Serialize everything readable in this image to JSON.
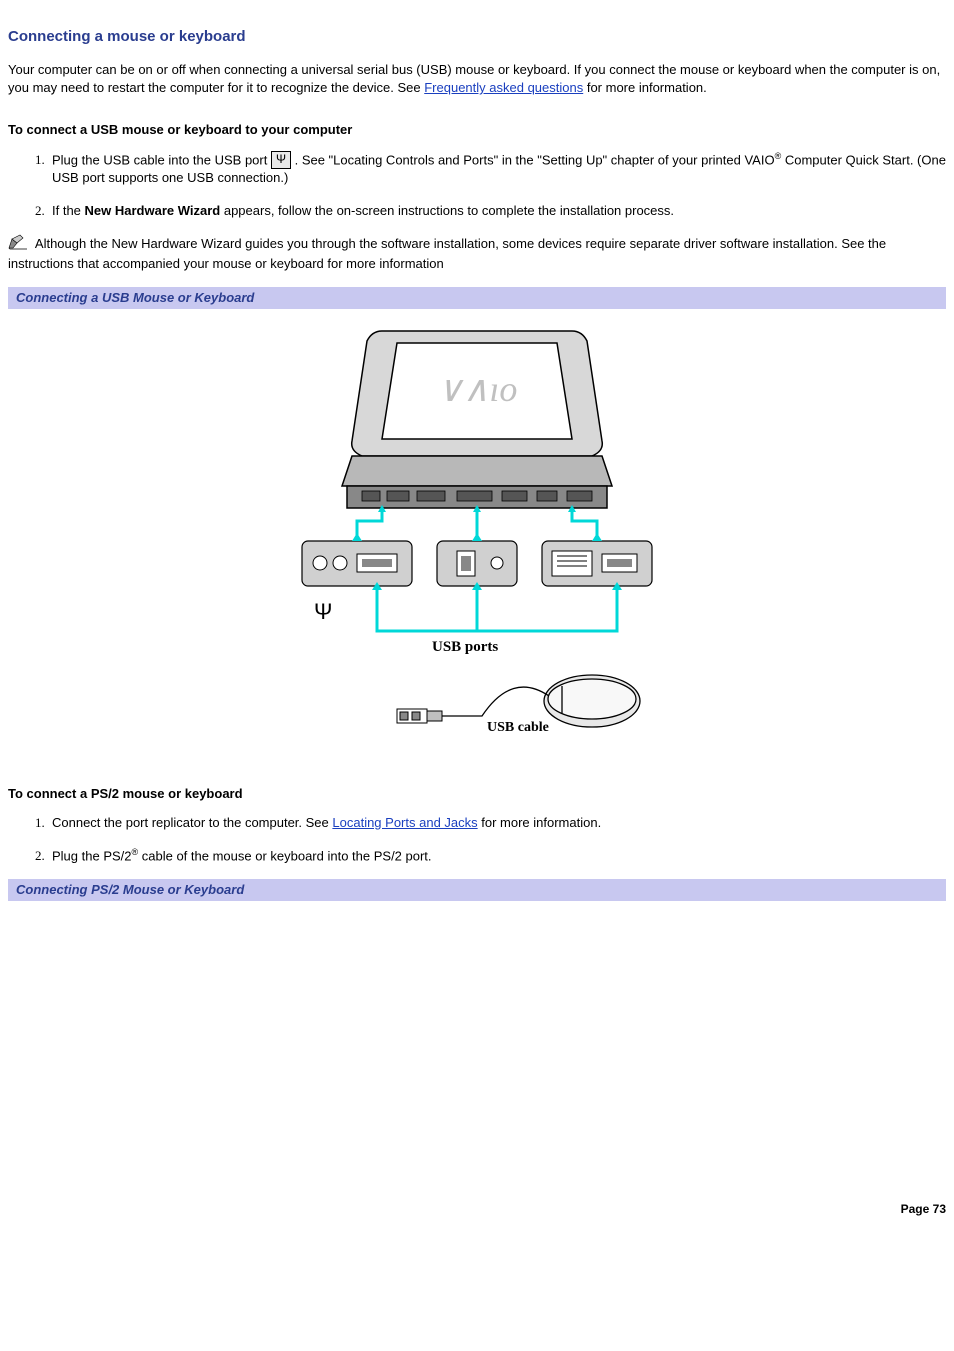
{
  "title": "Connecting a mouse or keyboard",
  "intro_part1": "Your computer can be on or off when connecting a universal serial bus (USB) mouse or keyboard. If you connect the mouse or keyboard when the computer is on, you may need to restart the computer for it to recognize the device. See ",
  "intro_link": "Frequently asked questions",
  "intro_part2": " for more information.",
  "usb_heading": "To connect a USB mouse or keyboard to your computer",
  "usb_step1_a": "Plug the USB cable into the USB port ",
  "usb_step1_b": ". See \"Locating Controls and Ports\" in the \"Setting Up\" chapter of your printed VAIO",
  "usb_step1_c": " Computer Quick Start. (One USB port supports one USB connection.)",
  "usb_step2_a": "If the ",
  "usb_step2_bold": "New Hardware Wizard",
  "usb_step2_b": " appears, follow the on-screen instructions to complete the installation process.",
  "note_text": "Although the New Hardware Wizard guides you through the software installation, some devices require separate driver software installation. See the instructions that accompanied your mouse or keyboard for more information",
  "fig1_caption": "Connecting a USB Mouse or Keyboard",
  "fig1_label_ports": "USB ports",
  "fig1_label_cable": "USB cable",
  "ps2_heading": "To connect a PS/2 mouse or keyboard",
  "ps2_step1_a": "Connect the port replicator to the computer. See ",
  "ps2_step1_link": "Locating Ports and Jacks",
  "ps2_step1_b": " for more information.",
  "ps2_step2_a": "Plug the PS/2",
  "ps2_step2_b": " cable of the mouse or keyboard into the PS/2 port.",
  "fig2_caption": "Connecting PS/2 Mouse or Keyboard",
  "reg_mark": "®",
  "page_number": "Page 73"
}
